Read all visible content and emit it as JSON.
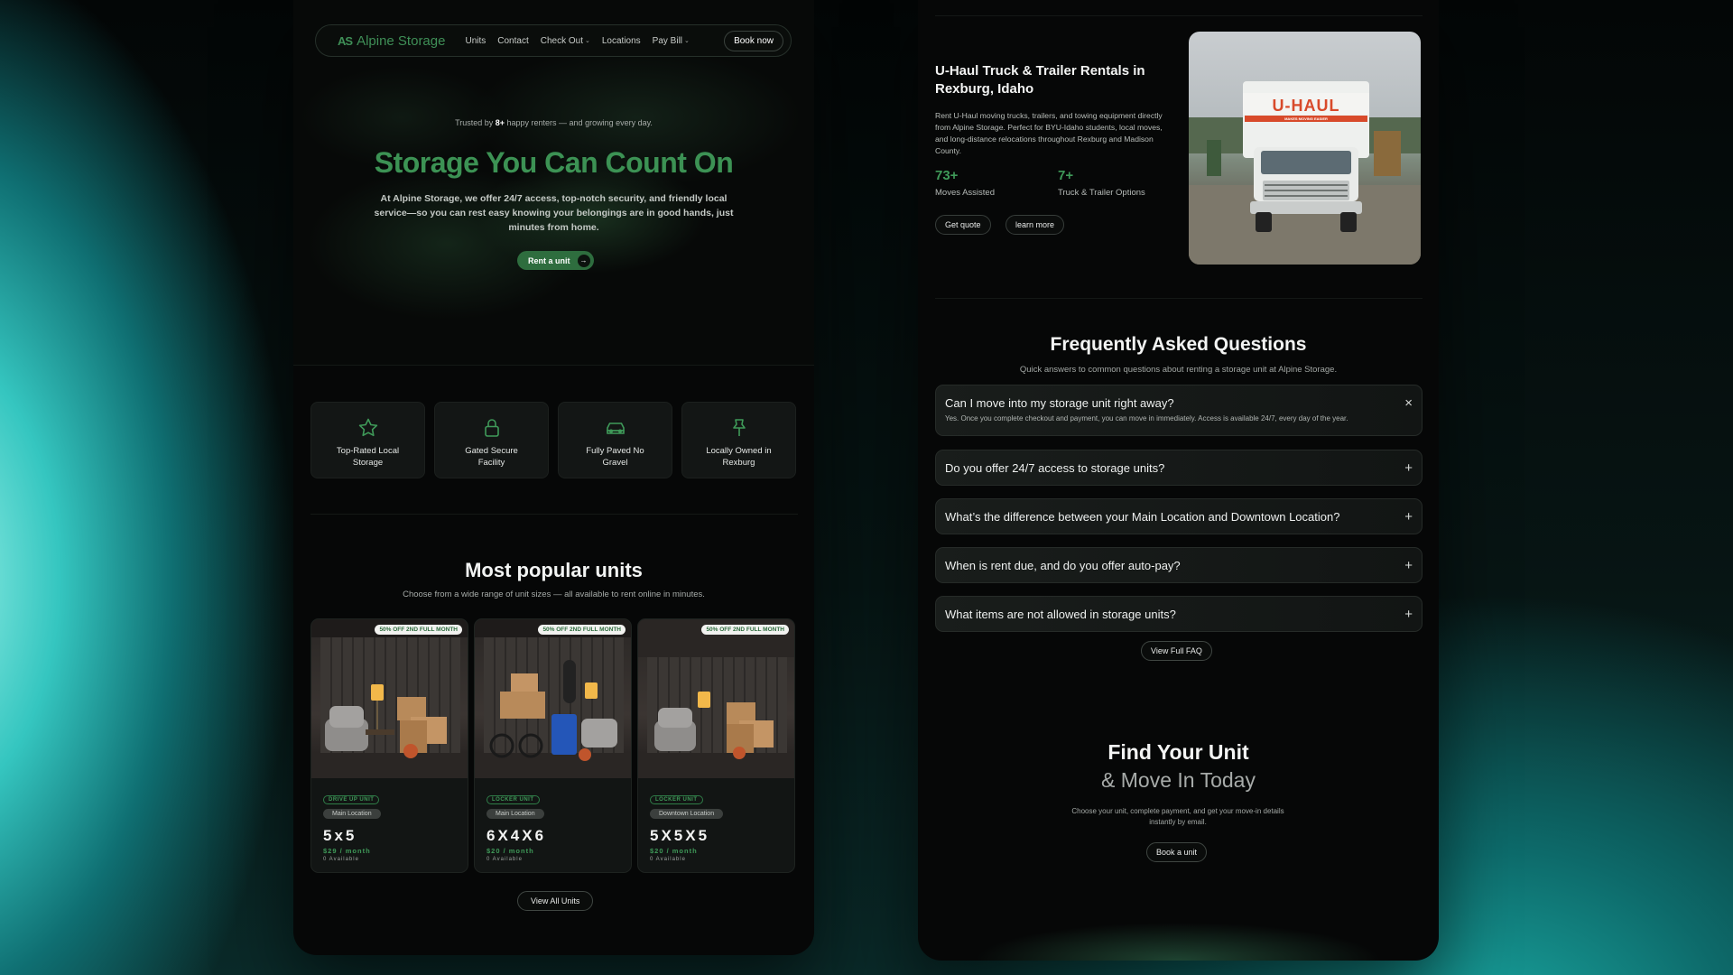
{
  "left": {
    "nav": {
      "logo_mark": "AS",
      "logo_text": "Alpine Storage",
      "links": [
        "Units",
        "Contact",
        "Check Out",
        "Locations",
        "Pay Bill"
      ],
      "book_label": "Book now"
    },
    "hero": {
      "trusted_prefix": "Trusted by ",
      "trusted_count": "8+",
      "trusted_suffix": " happy renters — and growing every day.",
      "title": "Storage You Can Count On",
      "description": "At Alpine Storage, we offer 24/7 access, top-notch security, and friendly local service—so you can rest easy knowing your belongings are in good hands, just minutes from home.",
      "cta_label": "Rent a unit"
    },
    "features": [
      {
        "label": "Top-Rated Local Storage",
        "icon": "star-icon"
      },
      {
        "label": "Gated Secure Facility",
        "icon": "lock-icon"
      },
      {
        "label": "Fully Paved No Gravel",
        "icon": "car-icon"
      },
      {
        "label": "Locally Owned in Rexburg",
        "icon": "pin-icon"
      }
    ],
    "units_section": {
      "title": "Most popular units",
      "subtitle": "Choose from a wide range of unit sizes — all available to rent online in minutes.",
      "units": [
        {
          "badge": "50% OFF 2ND FULL MONTH",
          "type": "DRIVE UP UNIT",
          "location": "Main Location",
          "size": "5x5",
          "price": "$29 / month",
          "available": "0 Available"
        },
        {
          "badge": "50% OFF 2ND FULL MONTH",
          "type": "LOCKER UNIT",
          "location": "Main Location",
          "size": "6X4X6",
          "price": "$20 / month",
          "available": "0 Available"
        },
        {
          "badge": "50% OFF 2ND FULL MONTH",
          "type": "LOCKER UNIT",
          "location": "Downtown Location",
          "size": "5X5X5",
          "price": "$20 / month",
          "available": "0 Available"
        }
      ],
      "view_all_label": "View All Units"
    }
  },
  "right": {
    "uhaul": {
      "title": "U-Haul Truck & Trailer Rentals in Rexburg, Idaho",
      "description": "Rent U-Haul moving trucks, trailers, and towing equipment directly from Alpine Storage. Perfect for BYU-Idaho students, local moves, and long-distance relocations throughout Rexburg and Madison County.",
      "stats": [
        {
          "value": "73+",
          "label": "Moves Assisted"
        },
        {
          "value": "7+",
          "label": "Truck & Trailer Options"
        }
      ],
      "quote_label": "Get quote",
      "learn_label": "learn more",
      "truck_brand": "U-HAUL",
      "truck_tagline": "MAKES MOVING EASIER"
    },
    "faq": {
      "title": "Frequently Asked Questions",
      "subtitle": "Quick answers to common questions about renting a storage unit at Alpine Storage.",
      "items": [
        {
          "question": "Can I move into my storage unit right away?",
          "answer": "Yes. Once you complete checkout and payment, you can move in immediately. Access is available 24/7, every day of the year.",
          "icon": "×"
        },
        {
          "question": "Do you offer 24/7 access to storage units?",
          "icon": "+"
        },
        {
          "question": "What’s the difference between your Main Location and Downtown Location?",
          "icon": "+"
        },
        {
          "question": "When is rent due, and do you offer auto-pay?",
          "icon": "+"
        },
        {
          "question": "What items are not allowed in storage units?",
          "icon": "+"
        }
      ],
      "view_full_label": "View Full FAQ"
    },
    "find": {
      "title": "Find Your Unit",
      "subtitle": "& Move In Today",
      "description": "Choose your unit, complete payment, and get your move-in details instantly by email.",
      "cta_label": "Book a unit"
    }
  }
}
